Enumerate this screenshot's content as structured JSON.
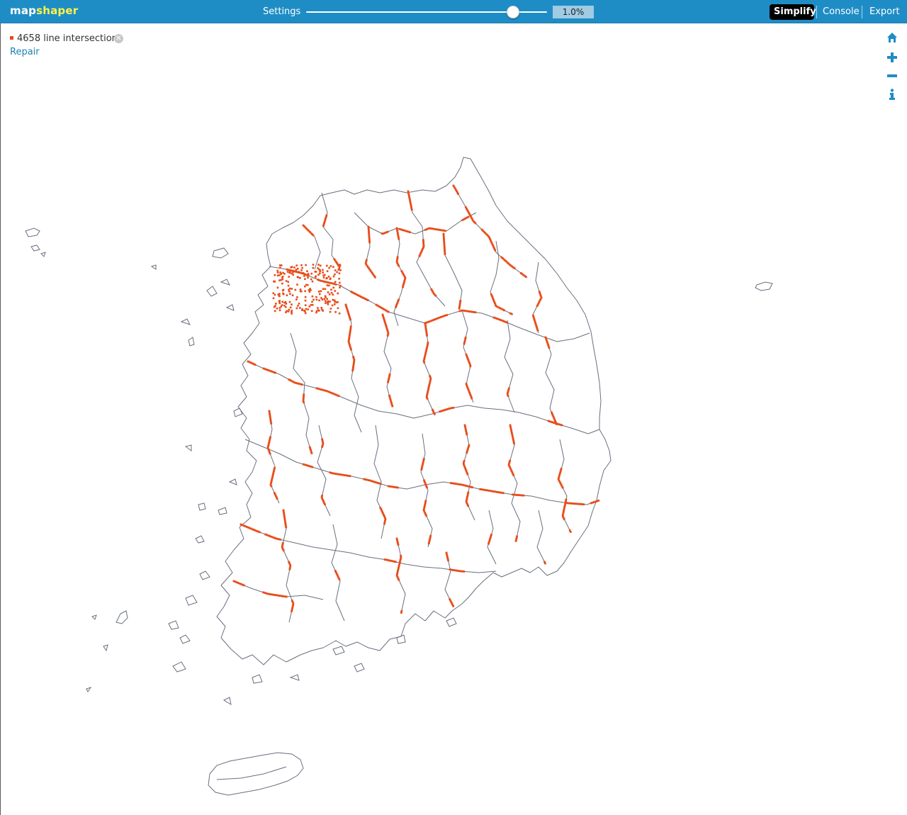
{
  "app": {
    "logo_part1": "map",
    "logo_part2": "shaper"
  },
  "toolbar": {
    "settings_label": "Settings",
    "simplification_value": 0.01,
    "simplification_display": "1.0%",
    "buttons": [
      {
        "label": "Simplify",
        "active": true
      },
      {
        "label": "Console",
        "active": false
      },
      {
        "label": "Export",
        "active": false
      }
    ]
  },
  "intersections": {
    "message": "4658 line intersections",
    "repair_label": "Repair",
    "marker_color": "#e74c1a"
  },
  "map_controls": [
    {
      "icon": "home-icon"
    },
    {
      "icon": "zoom-in-icon"
    },
    {
      "icon": "zoom-out-icon"
    },
    {
      "icon": "info-icon"
    }
  ],
  "colors": {
    "header_bg": "#1f8dc5",
    "accent": "#fff34a",
    "boundary_stroke": "#6a6f7e",
    "intersection": "#e74c1a"
  }
}
